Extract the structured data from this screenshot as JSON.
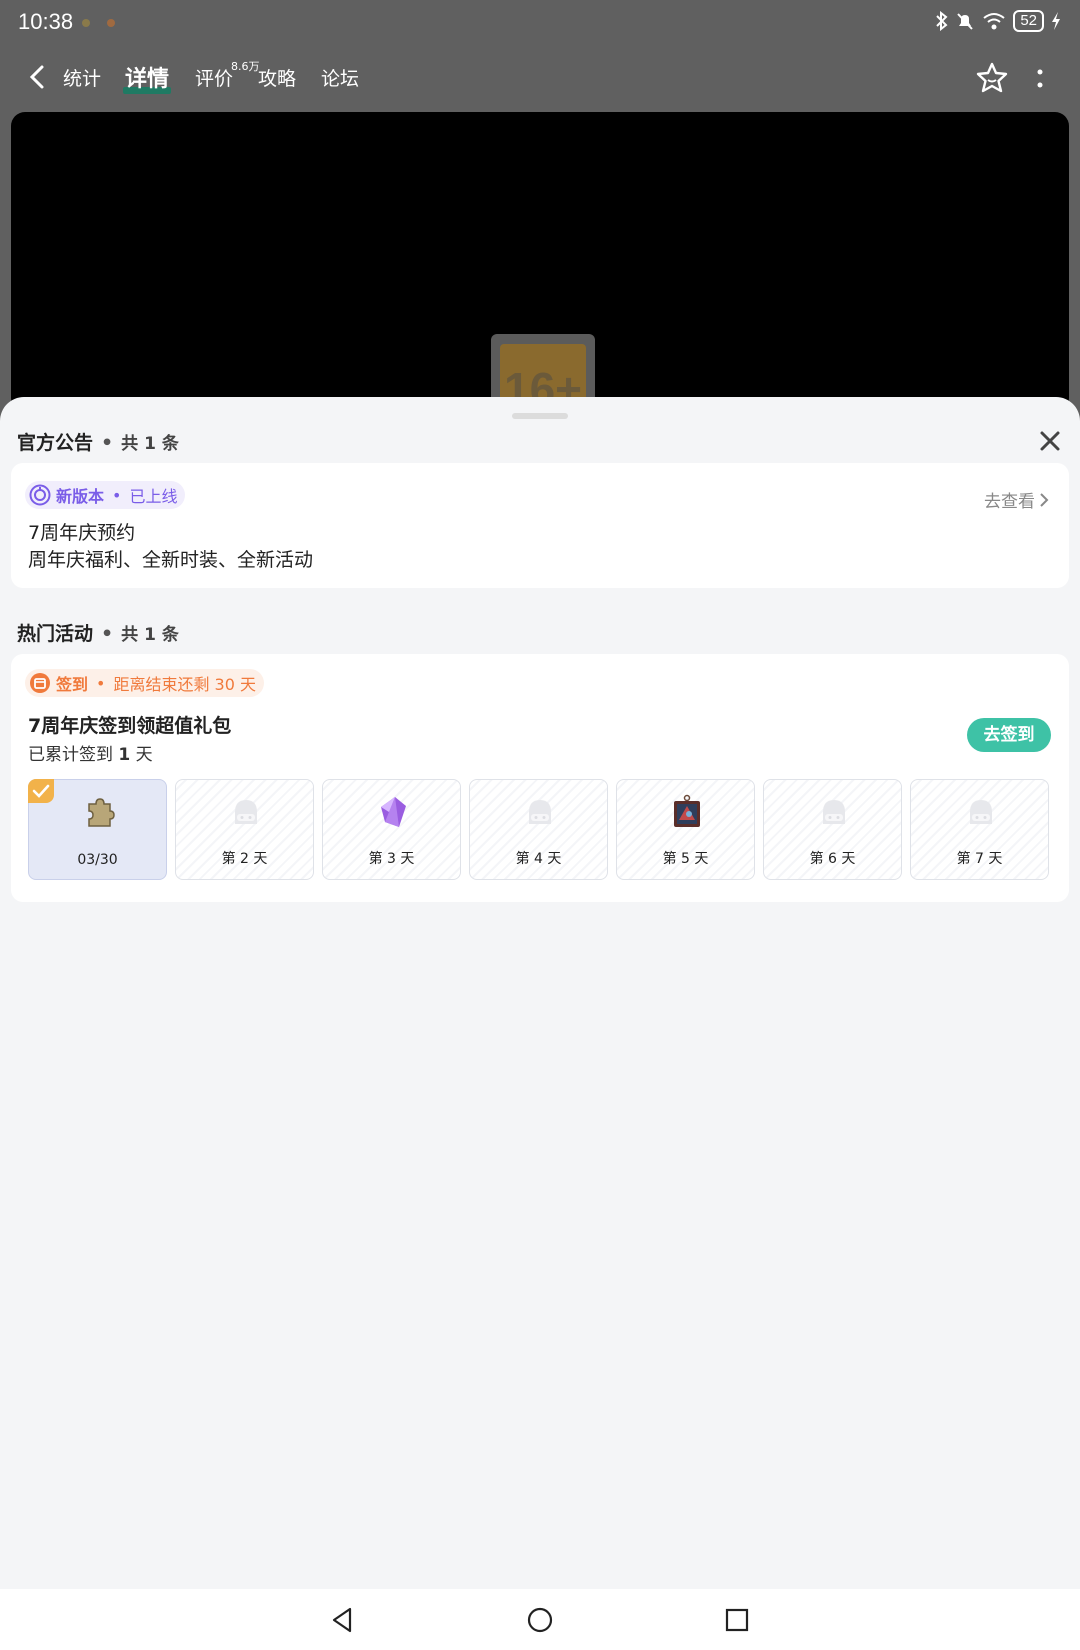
{
  "status_bar": {
    "time": "10:38",
    "battery": "52"
  },
  "top_nav": {
    "tabs": [
      "统计",
      "详情",
      "评价",
      "攻略",
      "论坛"
    ],
    "active_tab": "详情",
    "review_count": "8.6万"
  },
  "video": {
    "age_rating": "16+"
  },
  "announcements": {
    "title": "官方公告",
    "count": "共 1 条",
    "item": {
      "tag": "新版本",
      "status": "已上线",
      "line1": "7周年庆预约",
      "line2": "周年庆福利、全新时装、全新活动",
      "link": "去查看"
    }
  },
  "activities": {
    "title": "热门活动",
    "count": "共 1 条",
    "item": {
      "tag": "签到",
      "remaining": "距离结束还剩 30 天",
      "title": "7周年庆签到领超值礼包",
      "progress_prefix": "已累计签到",
      "progress_value": "1",
      "progress_suffix": "天",
      "button": "去签到",
      "days": [
        {
          "label": "03/30",
          "icon": "puzzle-icon",
          "checked": true
        },
        {
          "label": "第 2 天",
          "icon": "locked-gift-icon"
        },
        {
          "label": "第 3 天",
          "icon": "purple-crystal-icon"
        },
        {
          "label": "第 4 天",
          "icon": "locked-gift-icon"
        },
        {
          "label": "第 5 天",
          "icon": "card-pendant-icon"
        },
        {
          "label": "第 6 天",
          "icon": "locked-gift-icon"
        },
        {
          "label": "第 7 天",
          "icon": "locked-gift-icon"
        }
      ]
    }
  },
  "colors": {
    "accent_green": "#3ec2a6",
    "tag_purple": "#7a5de8",
    "tag_orange": "#f07a3c",
    "check_orange": "#f2b24a"
  }
}
